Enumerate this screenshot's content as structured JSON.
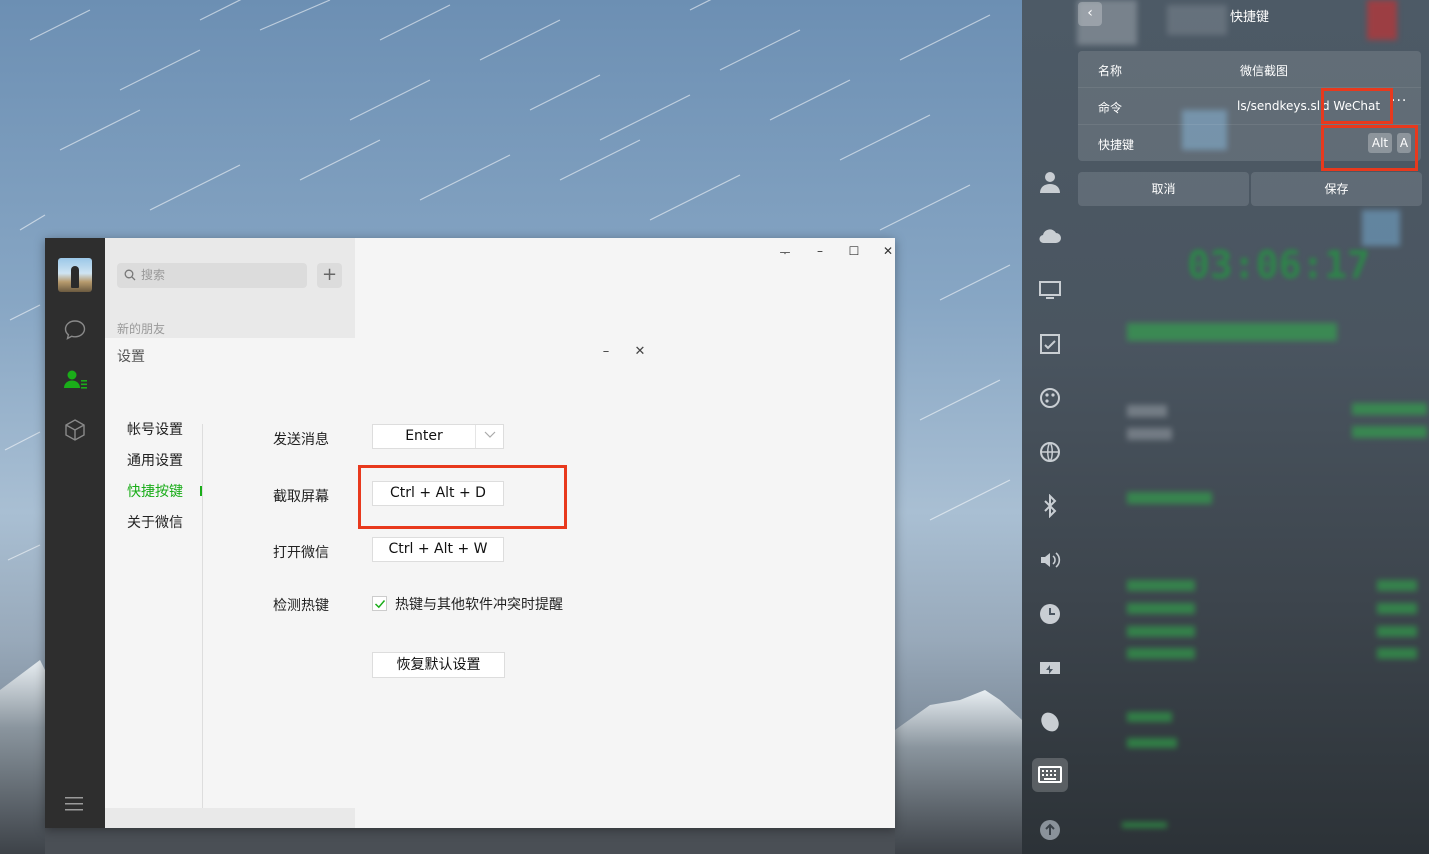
{
  "wechat": {
    "search_placeholder": "搜索",
    "add_label": "+",
    "new_friends_label": "新的朋友",
    "window_controls": {
      "pin": "ᅮ",
      "minimize": "–",
      "maximize": "☐",
      "close": "✕"
    }
  },
  "settings": {
    "title": "设置",
    "minimize": "–",
    "close": "✕",
    "menu": [
      {
        "label": "帐号设置",
        "active": false
      },
      {
        "label": "通用设置",
        "active": false
      },
      {
        "label": "快捷按键",
        "active": true
      },
      {
        "label": "关于微信",
        "active": false
      }
    ],
    "rows": {
      "send_message": {
        "label": "发送消息",
        "value": "Enter"
      },
      "screenshot": {
        "label": "截取屏幕",
        "value": "Ctrl + Alt + D"
      },
      "open_wechat": {
        "label": "打开微信",
        "value": "Ctrl + Alt + W"
      },
      "detect_hotkey": {
        "label": "检测热键",
        "checkbox_label": "热键与其他软件冲突时提醒",
        "checked": true
      }
    },
    "restore_label": "恢复默认设置"
  },
  "control_center": {
    "title": "快捷键",
    "back_icon": "‹",
    "form": {
      "name_label": "名称",
      "name_value": "微信截图",
      "command_label": "命令",
      "command_value": "ls/sendkeys.sl",
      "command_tail": "d WeChat",
      "more_label": "···",
      "shortcut_label": "快捷键",
      "keys": [
        "Alt",
        "A"
      ]
    },
    "cancel_label": "取消",
    "save_label": "保存"
  },
  "colors": {
    "accent_green": "#1aad19",
    "highlight_red": "#e8391d",
    "wechat_sidebar": "#2e2e2e"
  }
}
